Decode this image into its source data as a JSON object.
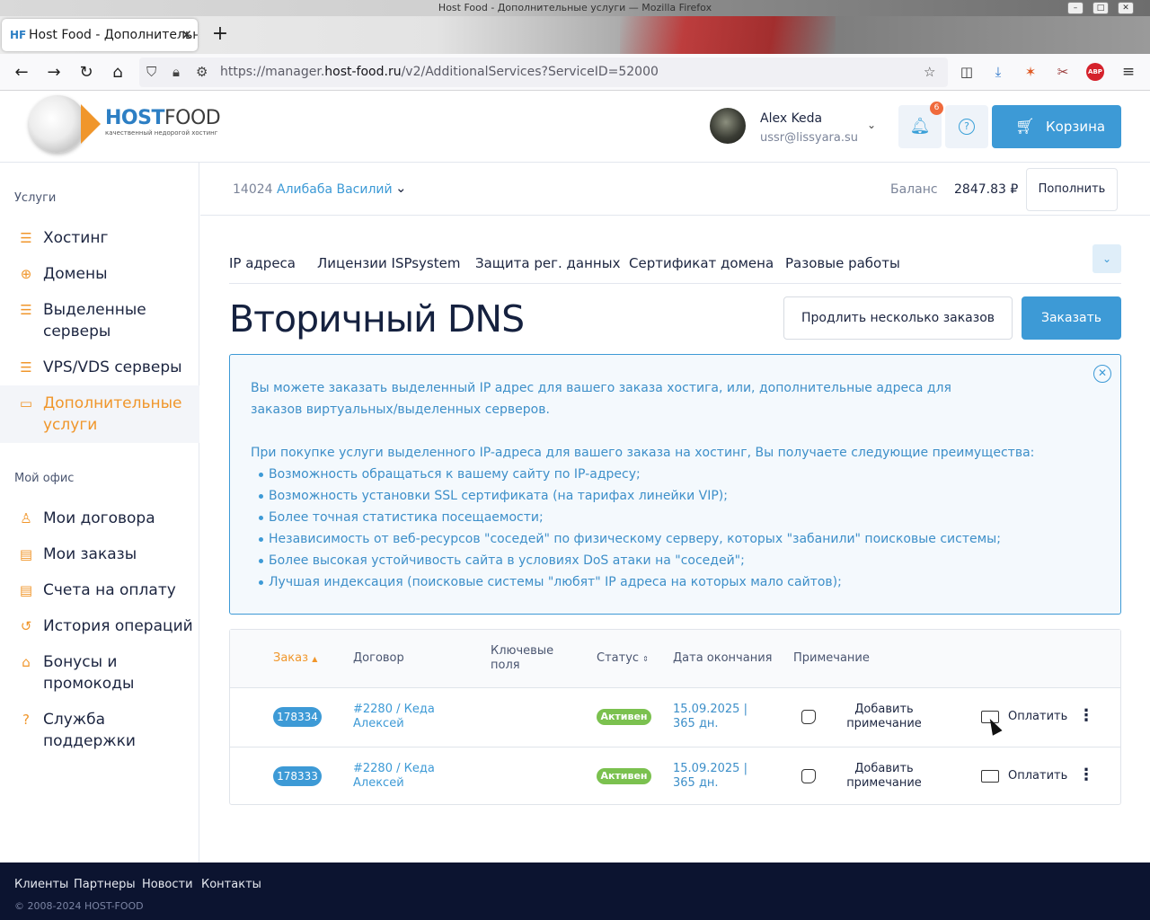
{
  "browser": {
    "window_title": "Host Food - Дополнительные услуги — Mozilla Firefox",
    "tab_title": "Host Food - Дополнительные услуги",
    "tab_favicon": "HF",
    "url_prefix": "https://manager.",
    "url_domain": "host-food.ru",
    "url_path": "/v2/AdditionalServices?ServiceID=52000",
    "icons": [
      "back-icon",
      "forward-icon",
      "reload-icon",
      "home-icon",
      "shield-icon",
      "lock-icon",
      "permissions-icon",
      "bookmark-star-icon",
      "pocket-icon",
      "downloads-icon",
      "extension-fox-icon",
      "extension-tool-icon",
      "adblock-icon",
      "menu-icon"
    ]
  },
  "header": {
    "logo_host": "HOST",
    "logo_food": "FOOD",
    "logo_tagline": "качественный недорогой хостинг",
    "user_name": "Alex Keda",
    "user_email": "ussr@lissyara.su",
    "notifications_count": "6",
    "cart_label": "Корзина"
  },
  "sidebar": {
    "services_label": "Услуги",
    "services": [
      {
        "label": "Хостинг",
        "icon": "hosting-icon"
      },
      {
        "label": "Домены",
        "icon": "globe-icon"
      },
      {
        "label": "Выделенные серверы",
        "icon": "server-icon"
      },
      {
        "label": "VPS/VDS серверы",
        "icon": "vps-icon"
      },
      {
        "label": "Дополнительные услуги",
        "icon": "addons-icon",
        "active": true
      }
    ],
    "office_label": "Мой офис",
    "office": [
      {
        "label": "Мои договора",
        "icon": "contracts-icon"
      },
      {
        "label": "Мои заказы",
        "icon": "orders-icon"
      },
      {
        "label": "Счета на оплату",
        "icon": "invoice-icon"
      },
      {
        "label": "История операций",
        "icon": "history-icon"
      },
      {
        "label": "Бонусы и промокоды",
        "icon": "tag-icon"
      },
      {
        "label": "Служба поддержки",
        "icon": "support-icon"
      }
    ]
  },
  "account": {
    "id": "14024",
    "name": "Алибаба Василий",
    "balance_label": "Баланс",
    "balance_value": "2847.83 ₽",
    "topup_label": "Пополнить"
  },
  "tabs": [
    "IP адреса",
    "Лицензии ISPsystem",
    "Защита рег. данных",
    "Сертификат домена",
    "Разовые работы"
  ],
  "page": {
    "title": "Вторичный DNS",
    "extend_button": "Продлить несколько заказов",
    "order_button": "Заказать"
  },
  "info": {
    "p1": "Вы можете заказать выделенный IP адрес для вашего заказа хостига, или, дополнительные адреса для заказов виртуальных/выделенных серверов.",
    "p2": "При покупке услуги выделенного IP-адреса для вашего заказа на хостинг, Вы получаете следующие преимущества:",
    "items": [
      "Возможность обращаться к вашему сайту по IP-адресу;",
      "Возможность установки SSL сертификата (на тарифах линейки VIP);",
      "Более точная статистика посещаемости;",
      "Независимость от веб-ресурсов \"соседей\" по физическому серверу, которых \"забанили\" поисковые системы;",
      "Более высокая устойчивость сайта в условиях DoS атаки на \"соседей\";",
      "Лучшая индексация (поисковые системы \"любят\" IP адреса на которых мало сайтов);"
    ]
  },
  "table": {
    "headers": {
      "order": "Заказ",
      "contract": "Договор",
      "keys": "Ключевые поля",
      "status": "Статус",
      "end": "Дата окончания",
      "note": "Примечание"
    },
    "rows": [
      {
        "id": "178334",
        "contract": "#2280 / Кеда Алексей",
        "status": "Активен",
        "end": "15.09.2025 | 365 дн.",
        "note": "Добавить примечание",
        "pay": "Оплатить"
      },
      {
        "id": "178333",
        "contract": "#2280 / Кеда Алексей",
        "status": "Активен",
        "end": "15.09.2025 | 365 дн.",
        "note": "Добавить примечание",
        "pay": "Оплатить"
      }
    ]
  },
  "footer": {
    "links": [
      "Клиенты",
      "Партнеры",
      "Новости",
      "Контакты"
    ],
    "copyright": "© 2008-2024 HOST-FOOD"
  },
  "colors": {
    "accent": "#3d9ad6",
    "orange": "#f0962b",
    "active_green": "#7bc14f",
    "footer": "#0c1430"
  }
}
